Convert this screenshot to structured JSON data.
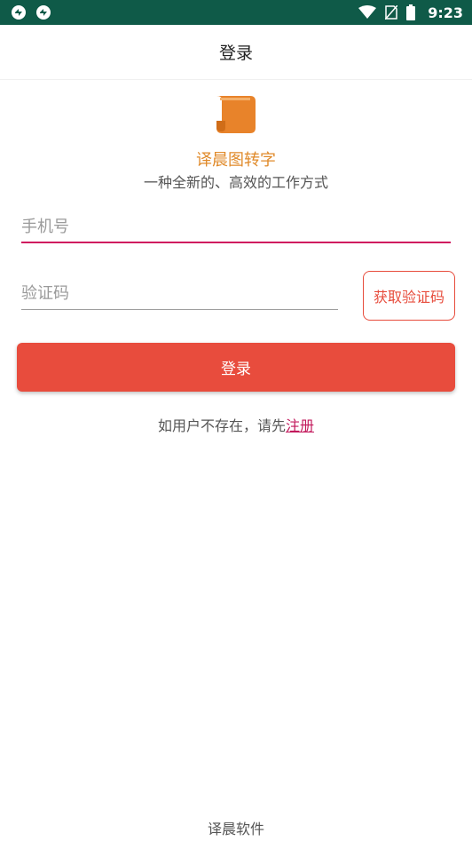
{
  "status_bar": {
    "time": "9:23",
    "left_icons": [
      "app-notification-icon",
      "app-notification-icon"
    ],
    "right_icons": [
      "wifi-icon",
      "no-sim-icon",
      "battery-icon"
    ]
  },
  "header": {
    "title": "登录"
  },
  "brand": {
    "logo_icon": "scroll-icon",
    "logo_color": "#e8832a",
    "app_name": "译晨图转字",
    "slogan": "一种全新的、高效的工作方式"
  },
  "form": {
    "phone_placeholder": "手机号",
    "phone_value": "",
    "code_placeholder": "验证码",
    "code_value": "",
    "get_code_label": "获取验证码",
    "login_label": "登录",
    "hint_text": "如用户不存在，请先",
    "register_label": "注册"
  },
  "footer": {
    "text": "译晨软件"
  },
  "colors": {
    "status_bar": "#0f5a48",
    "accent": "#e84c3d",
    "focus_underline": "#d0175f",
    "link": "#c2185b",
    "brand_text": "#e08a2a"
  }
}
